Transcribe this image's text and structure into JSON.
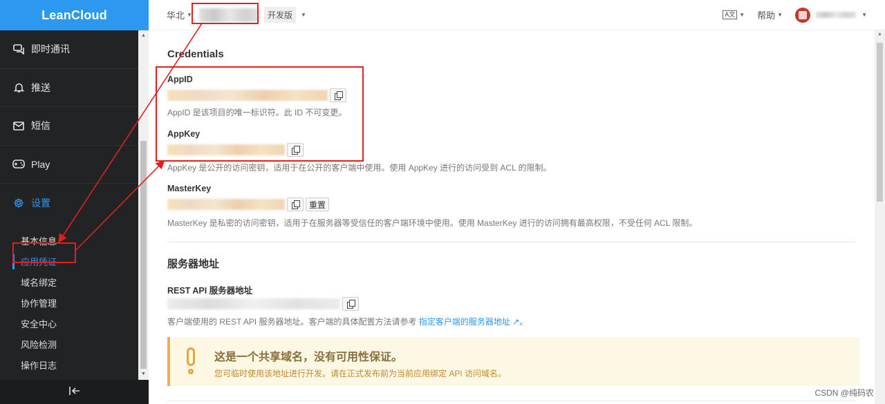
{
  "brand": "LeanCloud",
  "sidebar": {
    "items": [
      {
        "label": "即时通讯",
        "icon": "chat-icon"
      },
      {
        "label": "推送",
        "icon": "bell-icon"
      },
      {
        "label": "短信",
        "icon": "mail-icon"
      },
      {
        "label": "Play",
        "icon": "gamepad-icon"
      },
      {
        "label": "设置",
        "icon": "gear-icon"
      }
    ],
    "sub_items": [
      "基本信息",
      "应用凭证",
      "域名绑定",
      "协作管理",
      "安全中心",
      "风险检测",
      "操作日志"
    ],
    "active_sub": "应用凭证",
    "collapse_icon": "collapse-left-icon"
  },
  "topbar": {
    "region": "华北",
    "plan": "开发版",
    "language_icon": "A文",
    "help": "帮助"
  },
  "credentials": {
    "title": "Credentials",
    "appid_label": "AppID",
    "appid_help": "AppID 是该项目的唯一标识符。此 ID 不可变更。",
    "appkey_label": "AppKey",
    "appkey_help": "AppKey 是公开的访问密钥，适用于在公开的客户端中使用。使用 AppKey 进行的访问受到 ACL 的限制。",
    "masterkey_label": "MasterKey",
    "reset_label": "重置",
    "masterkey_help": "MasterKey 是私密的访问密钥，适用于在服务器等受信任的客户端环境中使用。使用 MasterKey 进行的访问拥有最高权限，不受任何 ACL 限制。"
  },
  "server": {
    "title": "服务器地址",
    "rest_label": "REST API 服务器地址",
    "help_prefix": "客户端使用的 REST API 服务器地址。客户端的具体配置方法请参考",
    "help_link": "指定客户端的服务器地址",
    "help_suffix": "。"
  },
  "warning": {
    "title": "这是一个共享域名，没有可用性保证。",
    "text": "您可临时使用该地址进行开发。请在正式发布前为当前应用绑定 API 访问域名。"
  },
  "watermark": "CSDN @纯码农"
}
